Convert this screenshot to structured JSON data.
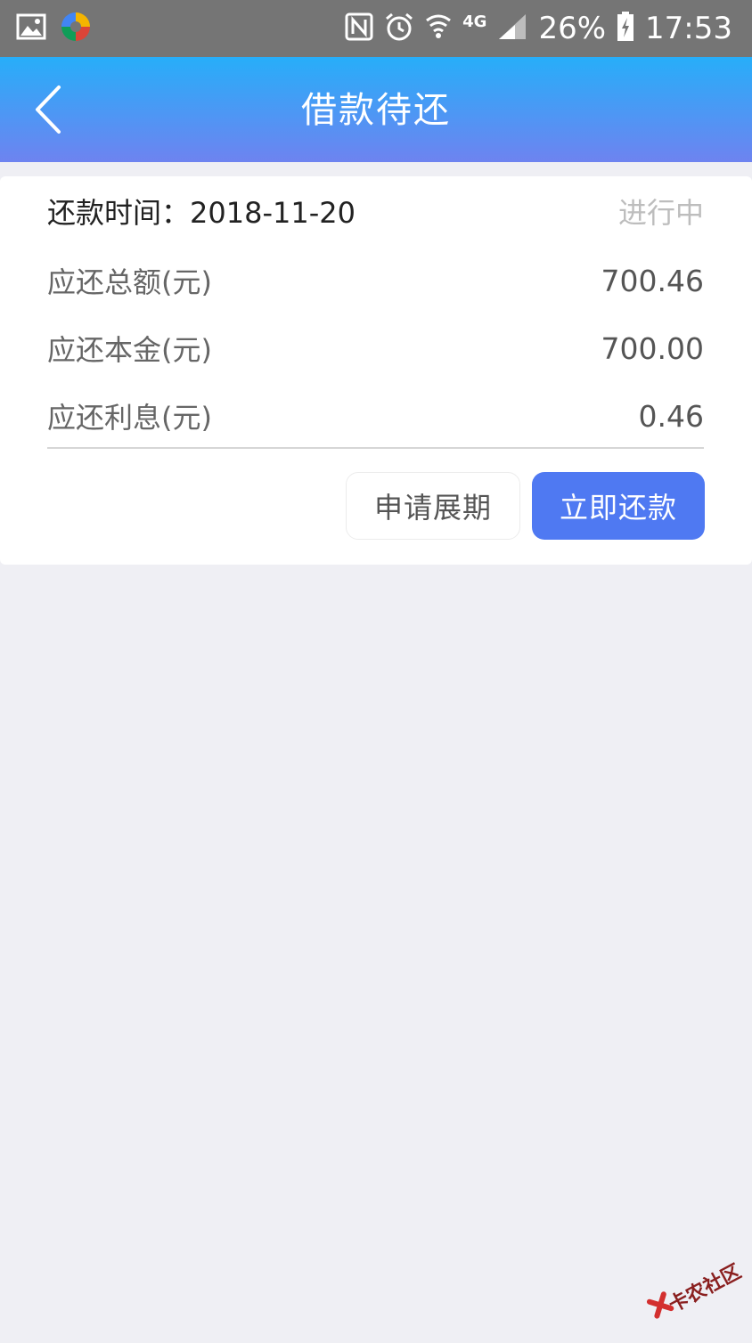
{
  "status_bar": {
    "network": "4G",
    "battery": "26%",
    "time": "17:53"
  },
  "header": {
    "title": "借款待还"
  },
  "loan": {
    "date_label": "还款时间：",
    "date_value": "2018-11-20",
    "status": "进行中",
    "total_label": "应还总额(元)",
    "total_value": "700.46",
    "principal_label": "应还本金(元)",
    "principal_value": "700.00",
    "interest_label": "应还利息(元)",
    "interest_value": "0.46"
  },
  "actions": {
    "extend_label": "申请展期",
    "repay_label": "立即还款"
  },
  "watermark": {
    "text": "卡农社区"
  },
  "colors": {
    "header_top": "#27aef9",
    "header_bottom": "#6e83f0",
    "primary_button": "#4f79f2",
    "page_background": "#efeff4"
  }
}
